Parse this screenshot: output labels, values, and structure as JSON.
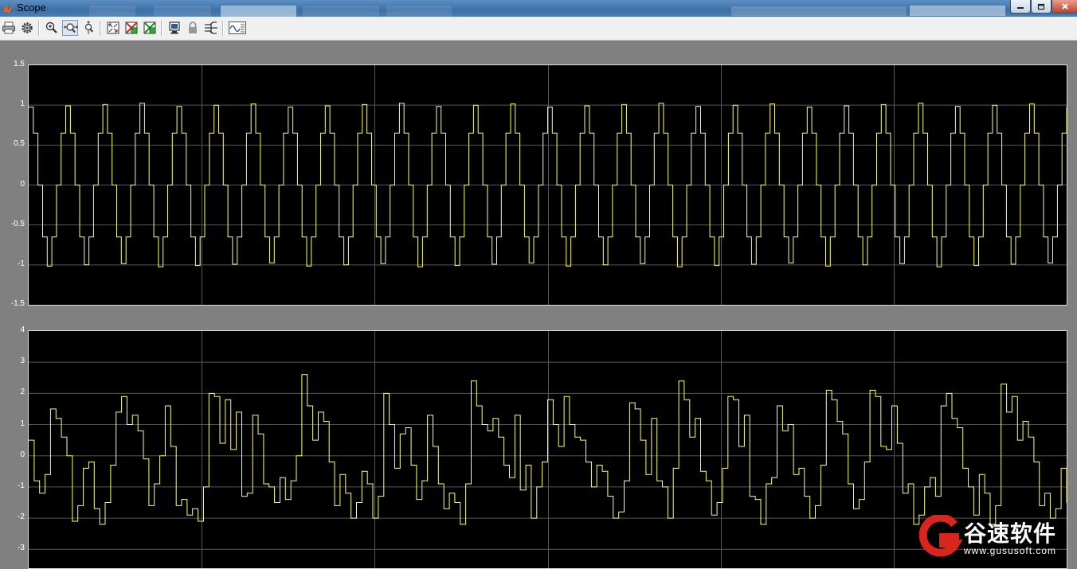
{
  "window": {
    "title": "Scope",
    "controls": [
      "minimize",
      "maximize",
      "close"
    ]
  },
  "toolbar": {
    "buttons": [
      {
        "name": "print-icon"
      },
      {
        "name": "parameters-icon"
      },
      {
        "name": "zoom-in-icon"
      },
      {
        "name": "zoom-x-icon",
        "pressed": true
      },
      {
        "name": "zoom-y-icon"
      },
      {
        "name": "autoscale-icon"
      },
      {
        "name": "save-axes-icon"
      },
      {
        "name": "restore-axes-icon"
      },
      {
        "name": "floating-scope-icon"
      },
      {
        "name": "lock-icon"
      },
      {
        "name": "signal-selection-icon"
      },
      {
        "name": "legend-icon"
      }
    ]
  },
  "colors": {
    "signal": "#ffff66",
    "plot_background": "#000000",
    "grid": "#555555",
    "figure_background": "#808080"
  },
  "chart_data": [
    {
      "type": "line",
      "step": true,
      "ylim": [
        -1.5,
        1.5
      ],
      "yticks": [
        "1.5",
        "1",
        "0.5",
        "0",
        "-0.5",
        "-1",
        "-1.5"
      ],
      "grid": true,
      "x_divisions": 6,
      "signal": "3-level stepped square-like wave, ~28 cycles, levels approx 0, ±0.65, ±1.0",
      "cycles": 28,
      "levels": [
        0,
        0.65,
        1.0,
        0.65,
        0,
        -0.65,
        -1.0,
        -0.65
      ]
    },
    {
      "type": "line",
      "step": true,
      "ylim": [
        -3.3,
        4
      ],
      "yticks": [
        "4",
        "3",
        "2",
        "1",
        "0",
        "-1",
        "-2",
        "-3"
      ],
      "grid": true,
      "x_divisions": 6,
      "y": [
        0.5,
        -0.8,
        -1.2,
        -0.6,
        1.5,
        1.2,
        0.6,
        0.0,
        -2.1,
        -1.6,
        -0.4,
        -0.2,
        -1.7,
        -2.2,
        -1.5,
        -0.3,
        1.4,
        1.9,
        1.0,
        1.3,
        0.8,
        -0.1,
        -1.6,
        -0.9,
        0.0,
        1.6,
        0.3,
        -1.6,
        -1.4,
        -1.9,
        -1.7,
        -2.1,
        -1.0,
        2.0,
        1.9,
        0.4,
        1.8,
        0.2,
        1.4,
        -1.3,
        -1.2,
        1.3,
        0.7,
        -0.9,
        -1.0,
        -1.5,
        -0.7,
        -1.4,
        -0.8,
        0.0,
        2.6,
        1.6,
        0.5,
        1.4,
        1.1,
        -0.2,
        -1.6,
        -0.6,
        -1.2,
        -2.0,
        -1.5,
        -0.5,
        -0.9,
        -2.0,
        -1.3,
        2.0,
        1.0,
        -0.4,
        0.7,
        0.9,
        -0.3,
        -1.4,
        -0.8,
        1.3,
        0.3,
        -0.9,
        -1.7,
        -1.2,
        -1.5,
        -2.2,
        -0.9,
        2.4,
        1.6,
        1.0,
        0.8,
        1.2,
        0.6,
        -0.3,
        -0.7,
        1.3,
        -1.1,
        -0.3,
        -2.0,
        -1.0,
        -0.2,
        1.8,
        1.0,
        0.3,
        1.9,
        1.0,
        0.6,
        0.5,
        -0.2,
        -1.0,
        -0.3,
        -0.5,
        -1.3,
        -2.0,
        -1.8,
        -0.8,
        1.7,
        1.5,
        0.5,
        -0.6,
        1.2,
        -0.8,
        -1.0,
        -2.0,
        -0.4,
        2.4,
        1.8,
        0.6,
        1.2,
        -0.5,
        -0.8,
        -1.9,
        -1.5,
        -0.4,
        1.9,
        1.8,
        0.3,
        1.3,
        -1.3,
        -1.4,
        -2.2,
        -0.9,
        -0.7,
        1.6,
        0.8,
        1.0,
        -0.6,
        -0.4,
        -1.3,
        -2.0,
        -1.6,
        -0.3,
        2.1,
        1.8,
        1.1,
        0.7,
        -0.9,
        -1.7,
        -1.4,
        -0.2,
        2.1,
        1.9,
        0.3,
        0.2,
        1.6,
        0.4,
        -1.2,
        -0.9,
        -2.2,
        -1.9,
        -1.0,
        -0.7,
        -1.3,
        1.6,
        2.0,
        1.2,
        0.9,
        -0.4,
        -1.0,
        -1.9,
        -0.6,
        -1.2,
        -2.2,
        -1.6,
        2.3,
        1.4,
        1.9,
        0.5,
        1.1,
        0.6,
        -0.2,
        -1.6,
        -1.2,
        -2.0,
        -1.7,
        -0.4,
        -1.5
      ]
    }
  ],
  "watermark": {
    "cn_text": "谷速软件",
    "url": "www.gususoft.com"
  }
}
